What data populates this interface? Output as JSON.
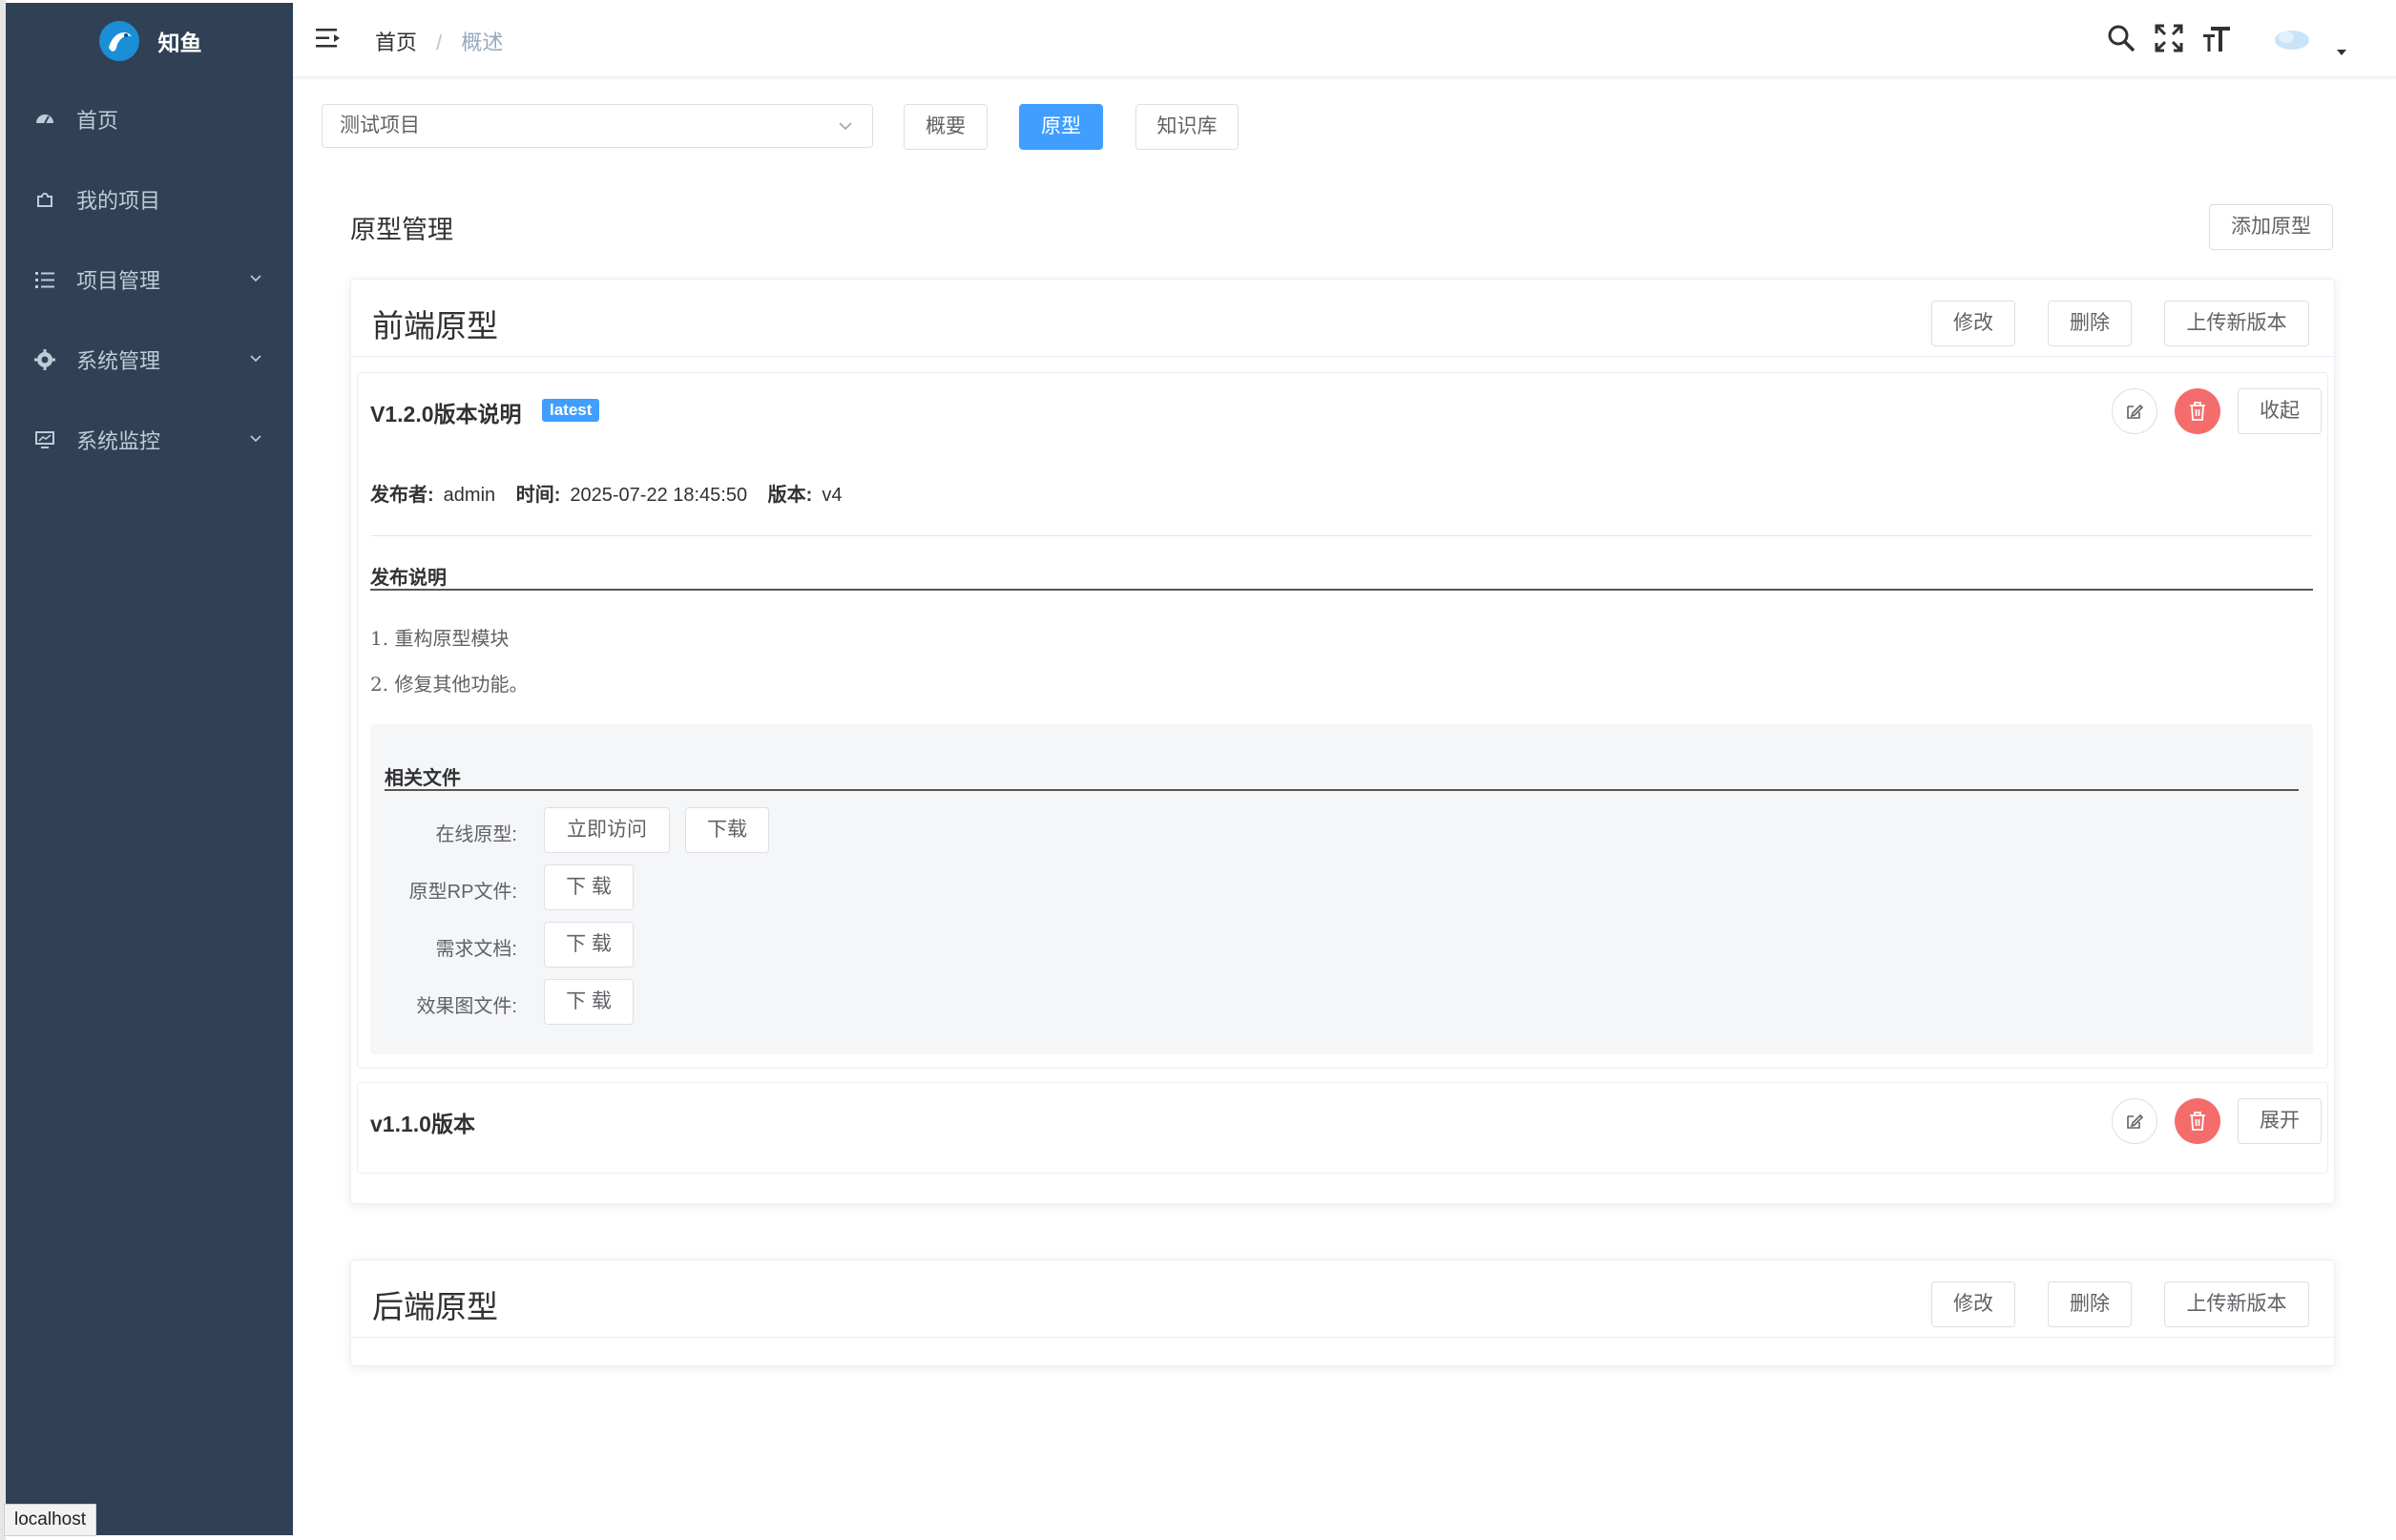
{
  "app": {
    "name": "知鱼"
  },
  "sidebar": {
    "items": [
      {
        "label": "首页",
        "icon": "dashboard-icon"
      },
      {
        "label": "我的项目",
        "icon": "puzzle-icon"
      },
      {
        "label": "项目管理",
        "icon": "list-icon",
        "expandable": true
      },
      {
        "label": "系统管理",
        "icon": "gear-icon",
        "expandable": true
      },
      {
        "label": "系统监控",
        "icon": "monitor-icon",
        "expandable": true
      }
    ]
  },
  "status_bar": {
    "url": "localhost"
  },
  "breadcrumb": {
    "home": "首页",
    "separator": "/",
    "current": "概述"
  },
  "toolbar": {
    "project_select": "测试项目",
    "tabs": [
      "概要",
      "原型",
      "知识库"
    ],
    "active_tab": "原型"
  },
  "section": {
    "title": "原型管理",
    "add_button": "添加原型"
  },
  "prototypes": [
    {
      "name": "前端原型",
      "actions": {
        "edit": "修改",
        "delete": "删除",
        "upload": "上传新版本"
      },
      "versions": [
        {
          "title": "V1.2.0版本说明",
          "tag": "latest",
          "toggle": "收起",
          "publisher_label": "发布者:",
          "publisher": "admin",
          "time_label": "时间:",
          "time": "2025-07-22 18:45:50",
          "version_label": "版本:",
          "version": "v4",
          "notes_heading": "发布说明",
          "notes": [
            "1. 重构原型模块",
            "2. 修复其他功能。"
          ],
          "files_heading": "相关文件",
          "files": {
            "online_label": "在线原型:",
            "visit": "立即访问",
            "download": "下载",
            "rp_label": "原型RP文件:",
            "rp_download": "下 载",
            "req_label": "需求文档:",
            "req_download": "下 载",
            "design_label": "效果图文件:",
            "design_download": "下 载"
          }
        },
        {
          "title": "v1.1.0版本",
          "toggle": "展开"
        }
      ]
    },
    {
      "name": "后端原型",
      "actions": {
        "edit": "修改",
        "delete": "删除",
        "upload": "上传新版本"
      }
    }
  ],
  "colors": {
    "sidebar_bg": "#304156",
    "primary": "#409eff",
    "danger": "#f56c6c"
  }
}
